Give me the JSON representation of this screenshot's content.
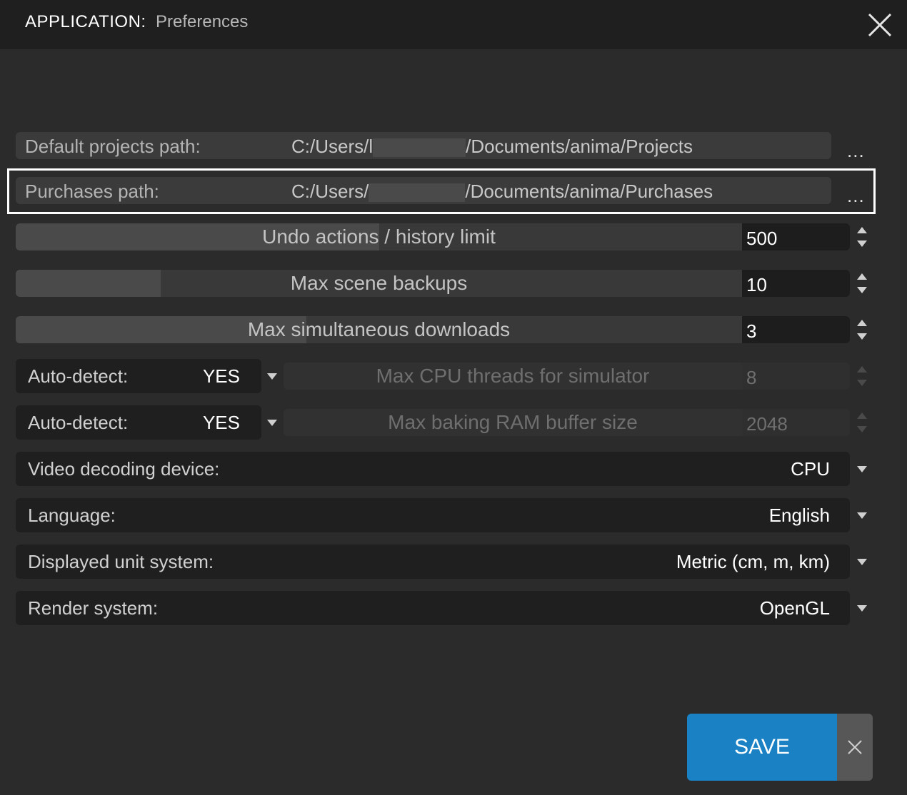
{
  "header": {
    "app": "APPLICATION:",
    "page": "Preferences"
  },
  "paths": [
    {
      "label": "Default projects path:",
      "prefix": "C:/Users/l",
      "suffix": "/Documents/anima/Projects",
      "browse": "..."
    },
    {
      "label": "Purchases path:",
      "prefix": "C:/Users/",
      "suffix": "/Documents/anima/Purchases",
      "browse": "..."
    }
  ],
  "sliders": [
    {
      "label": "Undo actions / history limit",
      "value": "500",
      "fill_fraction": 0.5,
      "enabled": true
    },
    {
      "label": "Max scene backups",
      "value": "10",
      "fill_fraction": 0.2,
      "enabled": true
    },
    {
      "label": "Max simultaneous downloads",
      "value": "3",
      "fill_fraction": 0.4,
      "enabled": true
    },
    {
      "label": "Max CPU threads for simulator",
      "value": "8",
      "enabled": false
    },
    {
      "label": "Max baking RAM buffer size",
      "value": "2048",
      "enabled": false
    }
  ],
  "autodetect": [
    {
      "label": "Auto-detect:",
      "value": "YES"
    },
    {
      "label": "Auto-detect:",
      "value": "YES"
    }
  ],
  "dropdowns": [
    {
      "label": "Video decoding device:",
      "value": "CPU"
    },
    {
      "label": "Language:",
      "value": "English"
    },
    {
      "label": "Displayed unit system:",
      "value": "Metric (cm, m, km)"
    },
    {
      "label": "Render system:",
      "value": "OpenGL"
    }
  ],
  "footer": {
    "save_label": "SAVE"
  },
  "icons": {
    "close": "close-icon",
    "spin": "spin-arrows-icon",
    "dropdown": "chevron-down-icon",
    "cancel": "close-icon"
  },
  "colors": {
    "accent": "#1a82c4",
    "background": "#2b2b2b",
    "titlebar": "#1f1f1f"
  }
}
